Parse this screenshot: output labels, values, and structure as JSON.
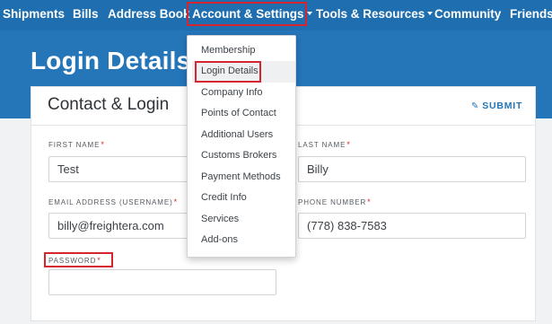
{
  "nav": {
    "items": [
      {
        "label": "Shipments",
        "dropdown": false
      },
      {
        "label": "Bills",
        "dropdown": false
      },
      {
        "label": "Address Book",
        "dropdown": false
      },
      {
        "label": "Account & Settings",
        "dropdown": true
      },
      {
        "label": "Tools & Resources",
        "dropdown": true
      },
      {
        "label": "Community",
        "dropdown": false
      },
      {
        "label": "Friends",
        "dropdown": false
      }
    ],
    "active": "Account & Settings"
  },
  "page": {
    "title": "Login Details"
  },
  "card": {
    "title": "Contact & Login",
    "submit_label": "SUBMIT",
    "fields": {
      "first_name": {
        "label": "FIRST NAME",
        "required_mark": "*",
        "value": "Test"
      },
      "last_name": {
        "label": "LAST NAME",
        "required_mark": "*",
        "value": "Billy"
      },
      "email": {
        "label": "EMAIL ADDRESS (USERNAME)",
        "required_mark": "*",
        "value": "billy@freightera.com"
      },
      "phone": {
        "label": "PHONE NUMBER",
        "required_mark": "*",
        "value": "(778) 838-7583"
      },
      "password": {
        "label": "PASSWORD",
        "required_mark": "*",
        "value": ""
      }
    }
  },
  "dropdown": {
    "items": [
      "Membership",
      "Login Details",
      "Company Info",
      "Points of Contact",
      "Additional Users",
      "Customs Brokers",
      "Payment Methods",
      "Credit Info",
      "Services",
      "Add-ons"
    ],
    "selected": "Login Details"
  },
  "colors": {
    "nav_bg": "#1f6fb0",
    "hero_bg": "#2575b9",
    "accent": "#2175b5",
    "highlight_outline": "#d6252e"
  },
  "icons": {
    "submit": "pencil-icon",
    "dropdown": "caret-down-icon"
  }
}
